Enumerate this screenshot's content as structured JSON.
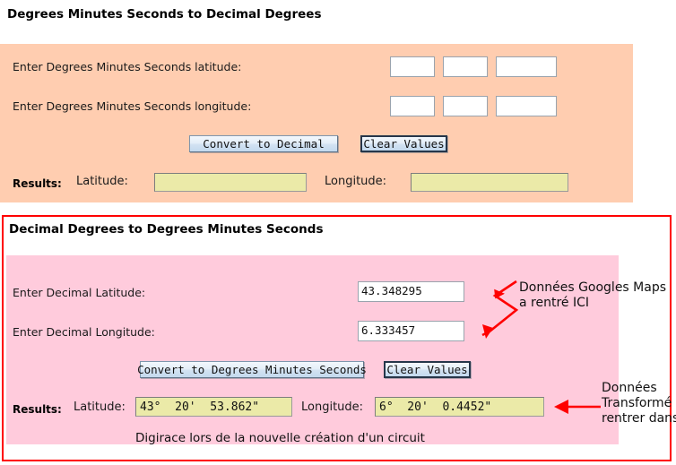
{
  "page": {
    "title": "Degrees Minutes Seconds to Decimal Degrees"
  },
  "section_dms_to_dd": {
    "latitude_label": "Enter Degrees Minutes Seconds latitude:",
    "longitude_label": "Enter Degrees Minutes Seconds longitude:",
    "latitude_inputs": [
      "",
      "",
      ""
    ],
    "longitude_inputs": [
      "",
      "",
      ""
    ],
    "convert_button": "Convert to Decimal",
    "clear_button": "Clear Values",
    "results_label": "Results:",
    "result_latitude_label": "Latitude:",
    "result_longitude_label": "Longitude:",
    "result_latitude_value": "",
    "result_longitude_value": "",
    "panel_color": "#ffcdb0",
    "result_field_color": "#ebeaa8"
  },
  "section_dd_to_dms": {
    "title": "Decimal Degrees to Degrees Minutes Seconds",
    "latitude_label": "Enter Decimal Latitude:",
    "longitude_label": "Enter Decimal Longitude:",
    "latitude_value": "43.348295",
    "longitude_value": "6.333457",
    "convert_button": "Convert to Degrees Minutes Seconds",
    "clear_button": "Clear Values",
    "results_label": "Results:",
    "result_latitude_label": "Latitude:",
    "result_longitude_label": "Longitude:",
    "result_latitude_value": "43°  20'  53.862\"",
    "result_longitude_value": "6°  20'  0.4452\"",
    "panel_color": "#ffcbdc",
    "highlight_border_color": "#ff0000"
  },
  "annotations": {
    "input_note": "Données Googles Maps\na rentré ICI",
    "output_note": "Données\nTransformé à\nrentrer dans",
    "footer_note": "Digirace lors de la nouvelle création d'un circuit",
    "arrow_color": "#ff0000"
  }
}
